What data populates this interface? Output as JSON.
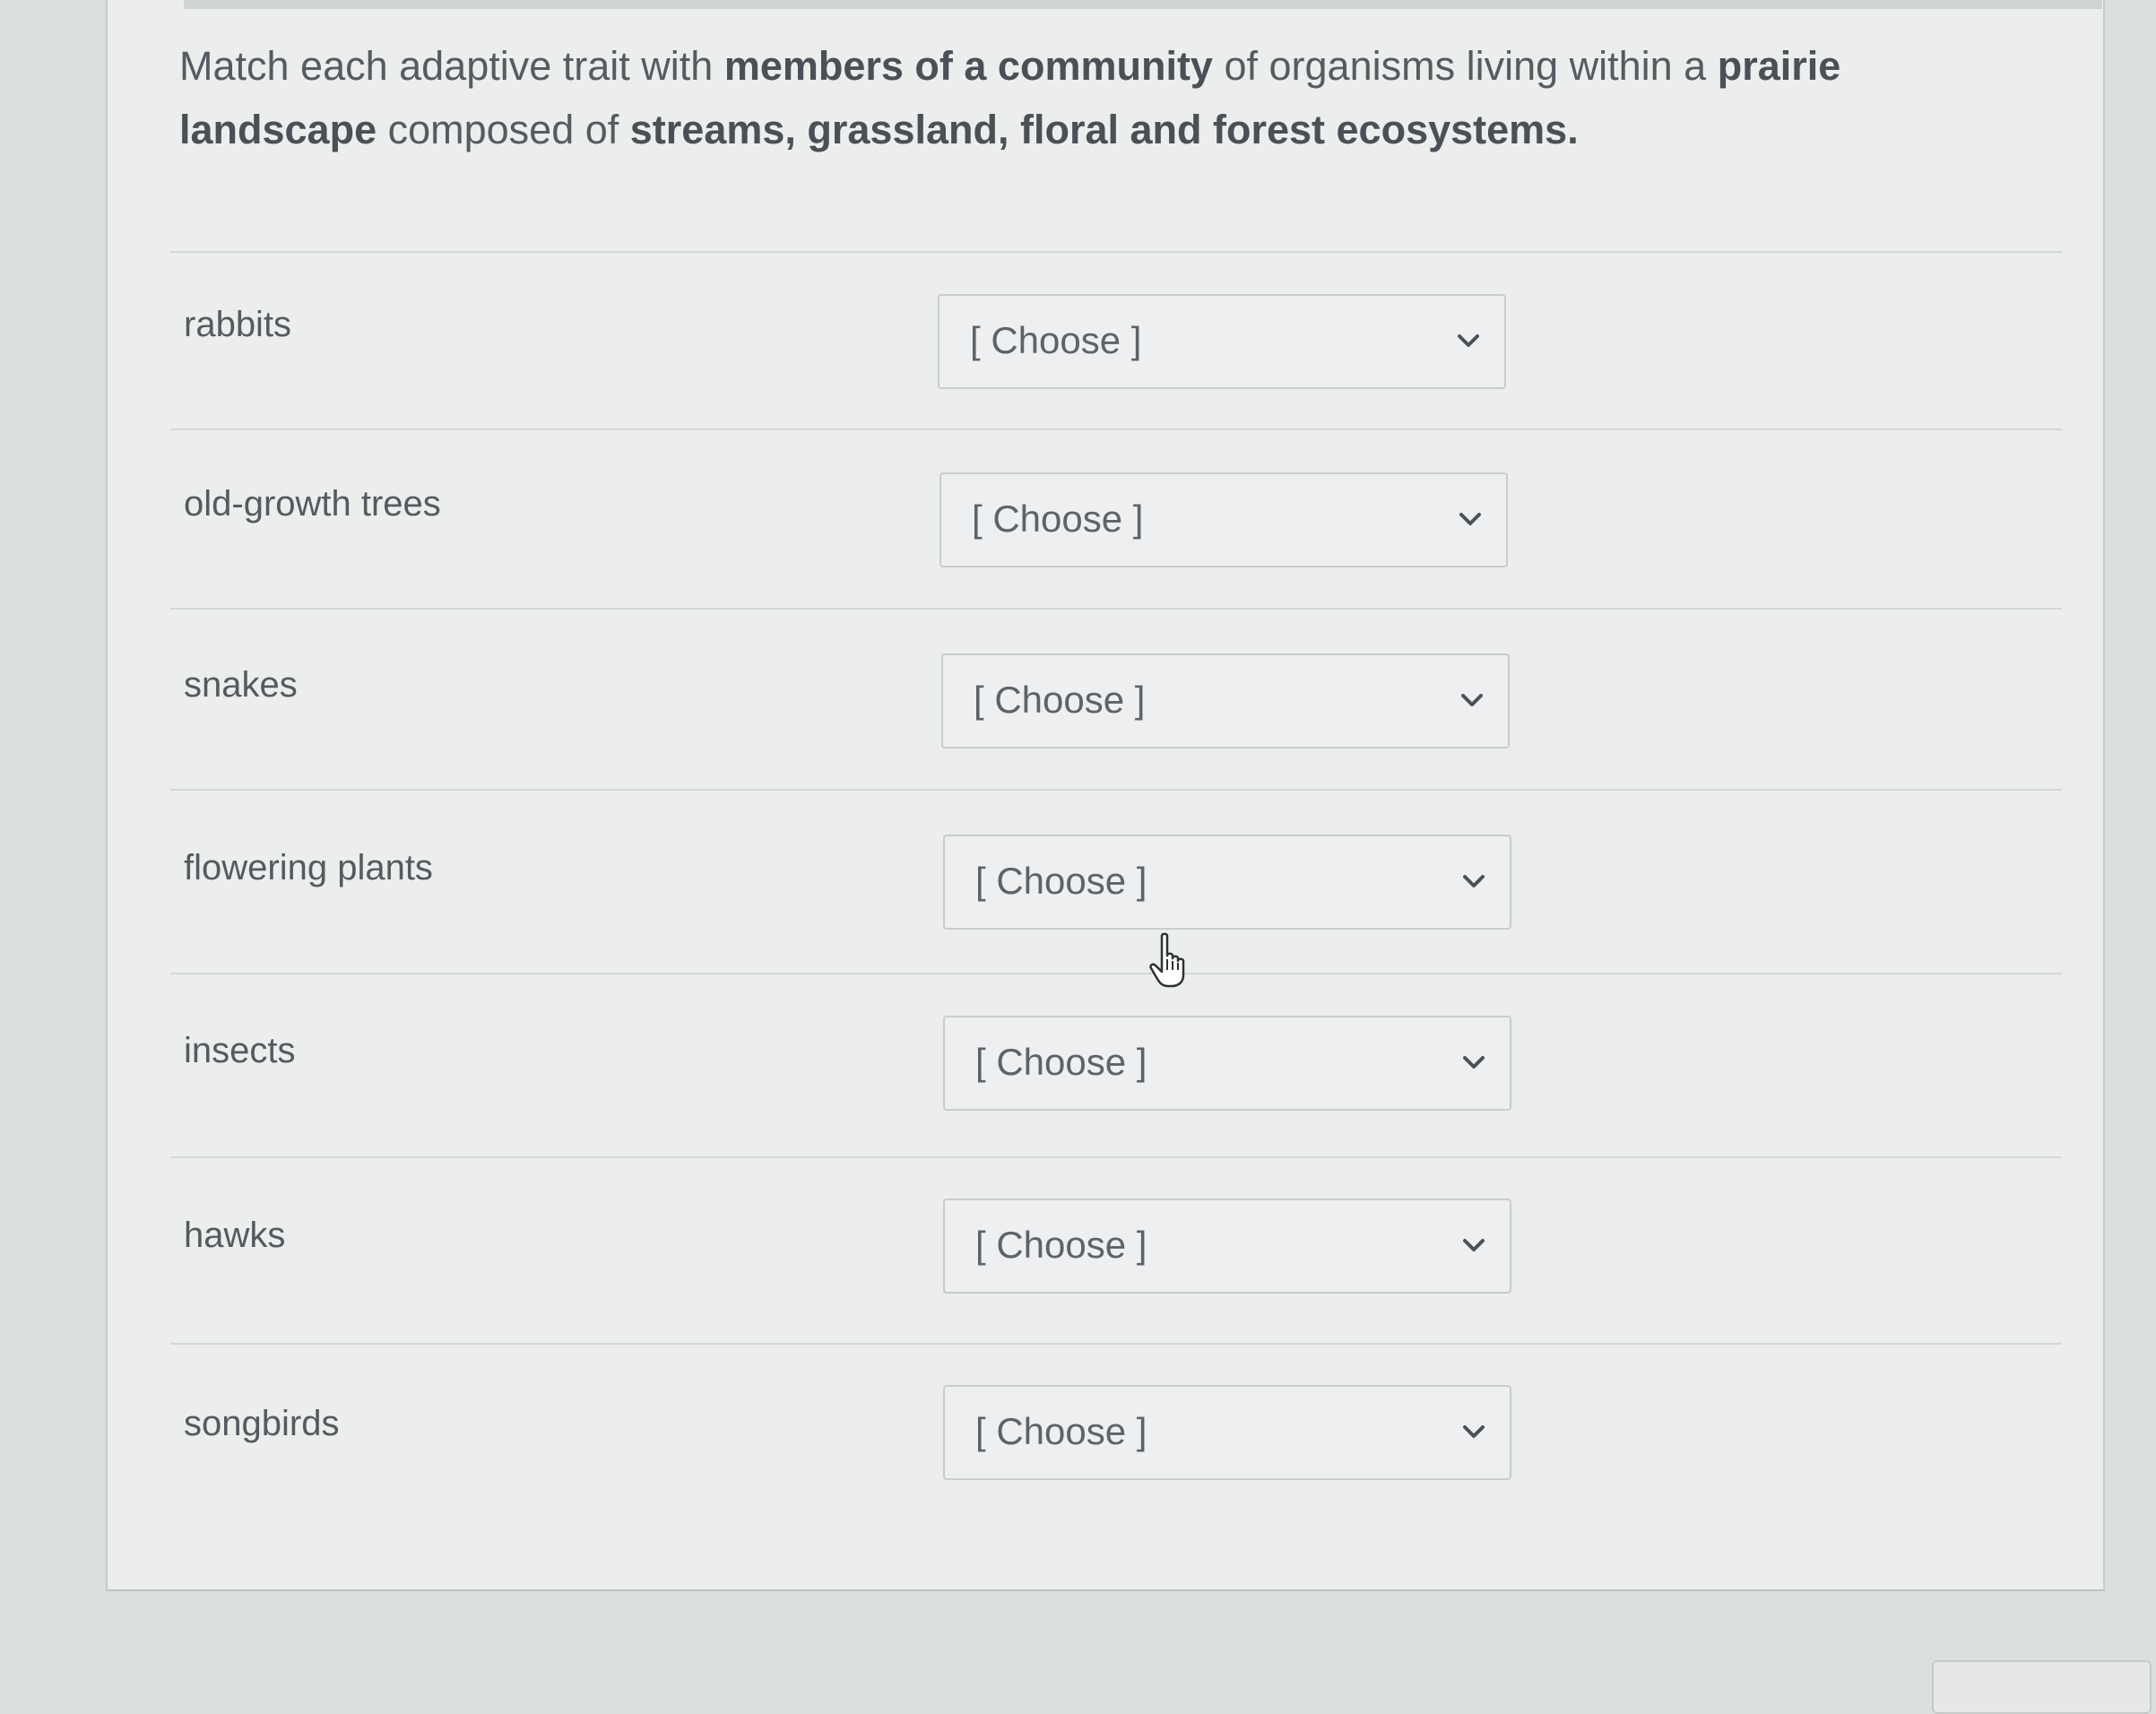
{
  "question": {
    "parts": [
      {
        "text": "Match each adaptive trait with ",
        "bold": false
      },
      {
        "text": "members of a community",
        "bold": true
      },
      {
        "text": " of organisms living within a ",
        "bold": false
      },
      {
        "text": "prairie landscape",
        "bold": true
      },
      {
        "text": " composed of ",
        "bold": false
      },
      {
        "text": "streams, grassland, floral and forest ecosystems.",
        "bold": true
      }
    ]
  },
  "rows": [
    {
      "term": "rabbits",
      "selected": "[ Choose ]"
    },
    {
      "term": "old-growth trees",
      "selected": "[ Choose ]"
    },
    {
      "term": "snakes",
      "selected": "[ Choose ]"
    },
    {
      "term": "flowering plants",
      "selected": "[ Choose ]"
    },
    {
      "term": "insects",
      "selected": "[ Choose ]"
    },
    {
      "term": "hawks",
      "selected": "[ Choose ]"
    },
    {
      "term": "songbirds",
      "selected": "[ Choose ]"
    }
  ],
  "icons": {
    "dropdown": "chevron-down-icon",
    "cursor": "hand-pointer-icon"
  },
  "colors": {
    "panel": "#eceeed",
    "text": "#555b61",
    "border": "#c9cccc"
  }
}
